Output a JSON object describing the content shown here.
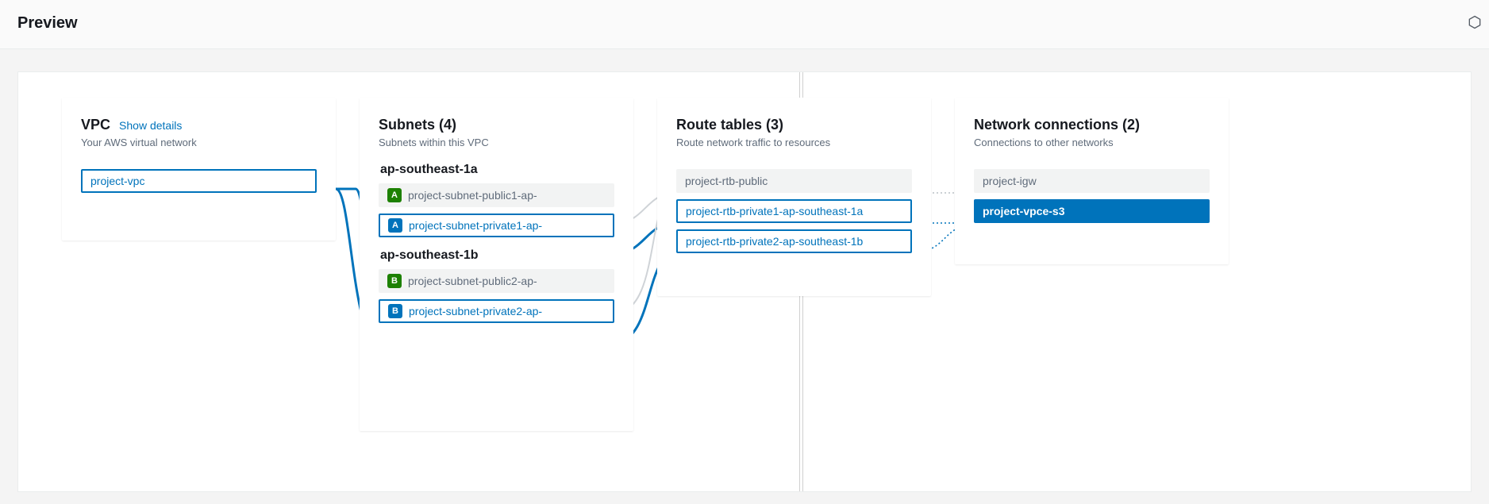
{
  "header": {
    "title": "Preview"
  },
  "vpc": {
    "title": "VPC",
    "show_details": "Show details",
    "caption": "Your AWS virtual network",
    "name": "project-vpc"
  },
  "subnets": {
    "title": "Subnets (4)",
    "caption": "Subnets within this VPC",
    "azs": [
      {
        "label": "ap-southeast-1a",
        "items": [
          {
            "badge": "A",
            "color": "green",
            "name": "project-subnet-public1-ap-",
            "state": "muted"
          },
          {
            "badge": "A",
            "color": "blue",
            "name": "project-subnet-private1-ap-",
            "state": "selected"
          }
        ]
      },
      {
        "label": "ap-southeast-1b",
        "items": [
          {
            "badge": "B",
            "color": "green",
            "name": "project-subnet-public2-ap-",
            "state": "muted"
          },
          {
            "badge": "B",
            "color": "blue",
            "name": "project-subnet-private2-ap-",
            "state": "selected"
          }
        ]
      }
    ]
  },
  "rtb": {
    "title": "Route tables (3)",
    "caption": "Route network traffic to resources",
    "items": [
      {
        "name": "project-rtb-public",
        "state": "muted"
      },
      {
        "name": "project-rtb-private1-ap-southeast-1a",
        "state": "selected"
      },
      {
        "name": "project-rtb-private2-ap-southeast-1b",
        "state": "selected"
      }
    ]
  },
  "net": {
    "title": "Network connections (2)",
    "caption": "Connections to other networks",
    "items": [
      {
        "name": "project-igw",
        "state": "muted"
      },
      {
        "name": "project-vpce-s3",
        "state": "active"
      }
    ]
  }
}
